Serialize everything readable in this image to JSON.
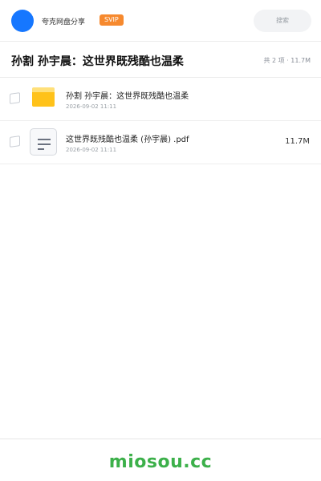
{
  "header": {
    "brand": "夸克网盘分享",
    "badge": "SVIP",
    "search_placeholder": "搜索"
  },
  "share": {
    "title": "孙割 孙宇晨：这世界既残酷也温柔",
    "summary": "共 2 项 · 11.7M"
  },
  "files": [
    {
      "type": "folder-icon",
      "name": "孙割 孙宇晨：这世界既残酷也温柔",
      "date": "2026-09-02 11:11",
      "size": ""
    },
    {
      "type": "document-icon",
      "name": "这世界既残酷也温柔 (孙宇晨) .pdf",
      "date": "2026-09-02 11:11",
      "size": "11.7M"
    }
  ],
  "colors": {
    "accent": "#1677ff",
    "badge": "#f6892e",
    "folder": "#ffc21a",
    "watermark": "#3cb04a"
  },
  "footer": {
    "watermark": "miosou.cc"
  }
}
